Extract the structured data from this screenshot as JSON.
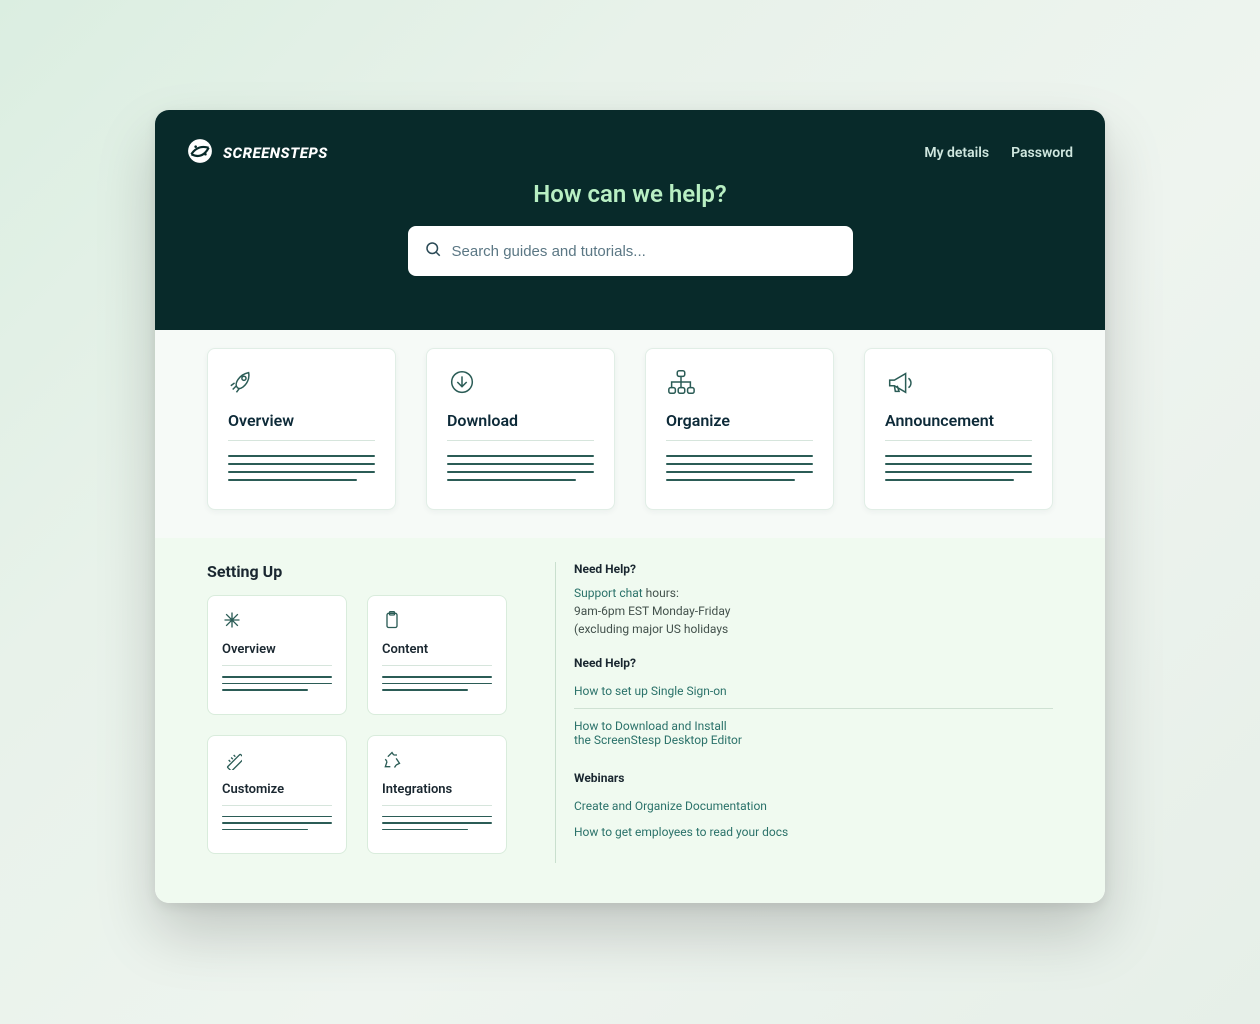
{
  "brand": {
    "name": "SCREENSTEPS"
  },
  "nav": {
    "my_details": "My details",
    "password": "Password"
  },
  "hero": {
    "title": "How can we help?",
    "search_placeholder": "Search guides and tutorials..."
  },
  "cards": [
    {
      "title": "Overview"
    },
    {
      "title": "Download"
    },
    {
      "title": "Organize"
    },
    {
      "title": "Announcement"
    }
  ],
  "setting_up": {
    "heading": "Setting Up",
    "items": [
      {
        "title": "Overview"
      },
      {
        "title": "Content"
      },
      {
        "title": "Customize"
      },
      {
        "title": "Integrations"
      }
    ]
  },
  "sidebar": {
    "need_help_1": {
      "heading": "Need Help?",
      "link_text": "Support chat",
      "rest1": " hours:",
      "line2": "9am-6pm EST Monday-Friday",
      "line3": "(excluding major US holidays"
    },
    "need_help_2": {
      "heading": "Need Help?",
      "item1": "How to set up Single Sign-on",
      "item2a": "How to Download and Install",
      "item2b": "the ScreenStesp Desktop Editor"
    },
    "webinars": {
      "heading": "Webinars",
      "item1": "Create and Organize Documentation",
      "item2": "How to get employees to read your docs"
    }
  }
}
